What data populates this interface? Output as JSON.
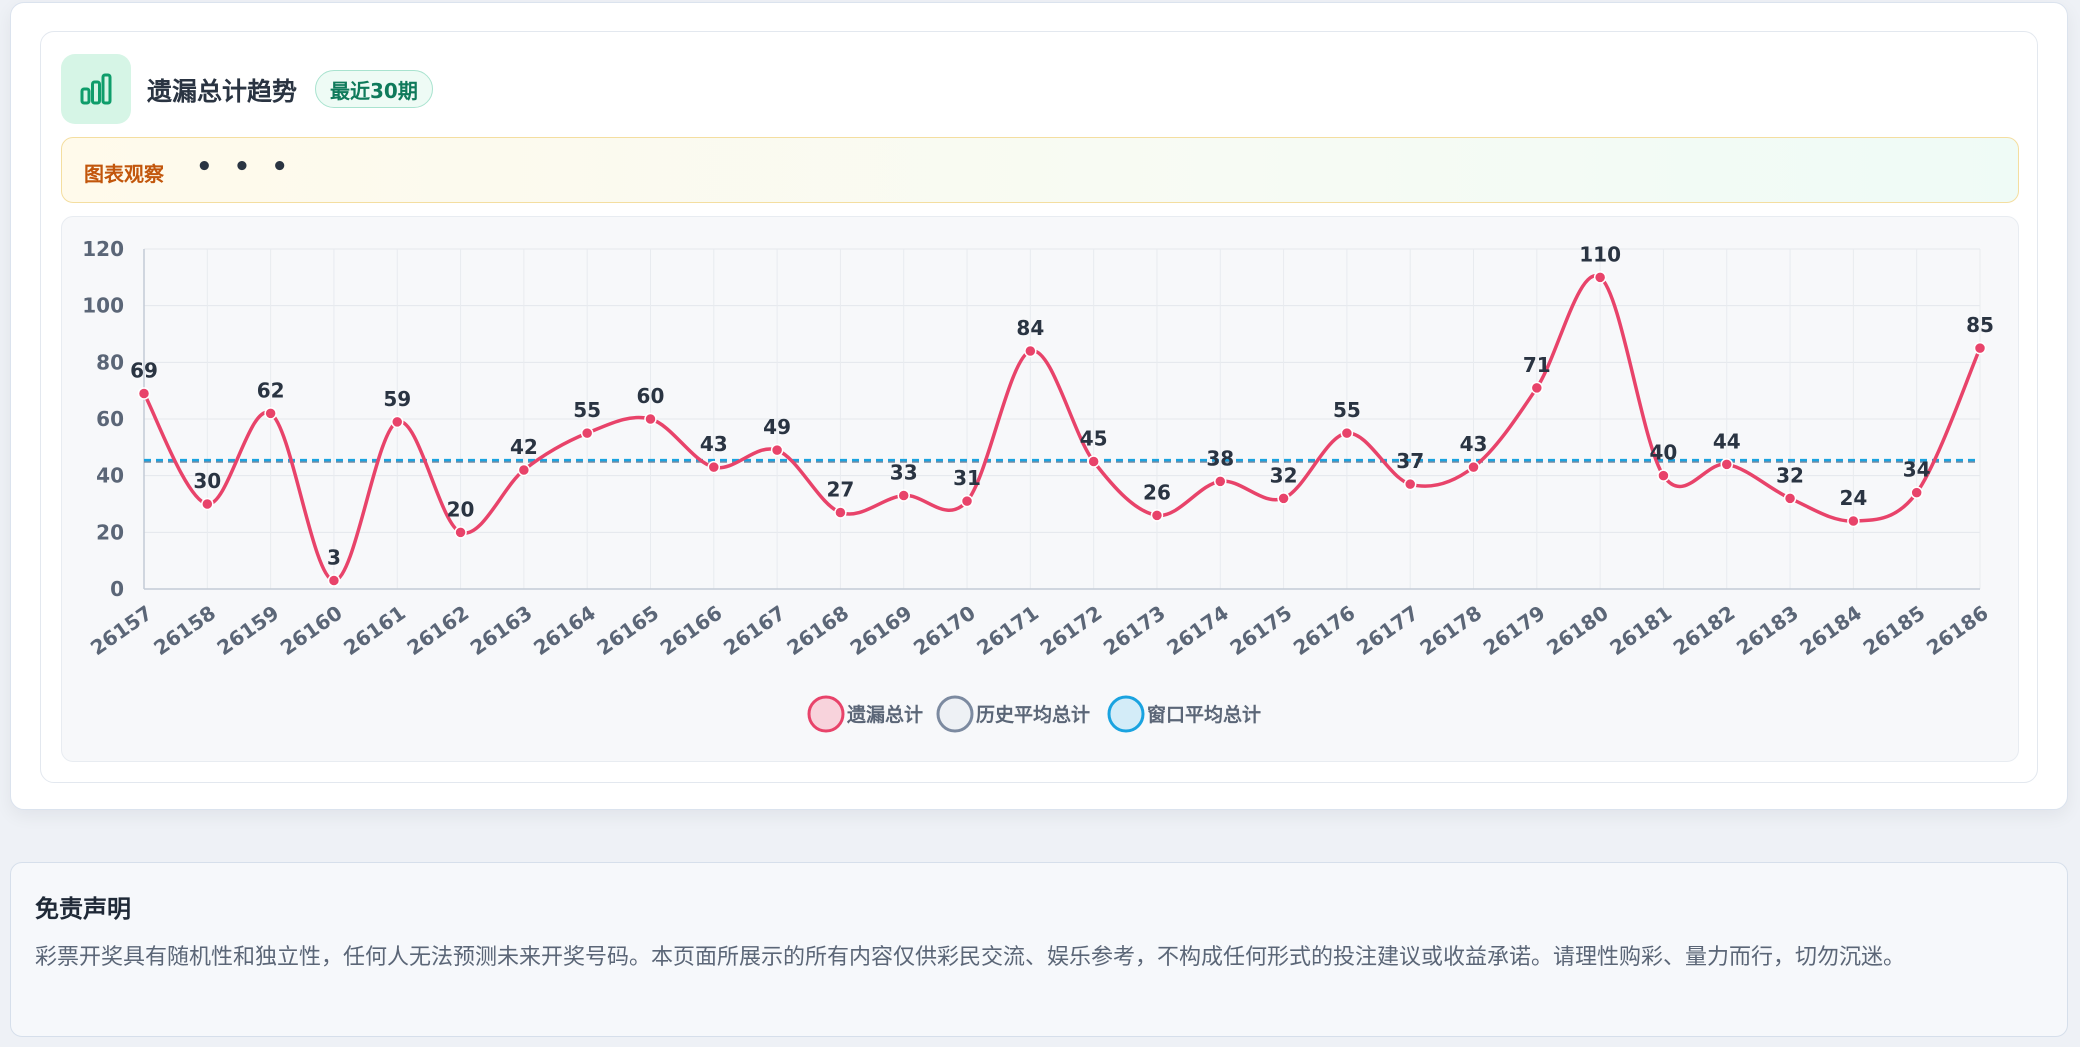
{
  "card": {
    "title": "遗漏总计趋势",
    "badge": "最近30期",
    "icon": "bar-chart-icon",
    "notice_label": "图表观察",
    "notice_dots": "• • •"
  },
  "chart_data": {
    "type": "line",
    "categories": [
      "26157",
      "26158",
      "26159",
      "26160",
      "26161",
      "26162",
      "26163",
      "26164",
      "26165",
      "26166",
      "26167",
      "26168",
      "26169",
      "26170",
      "26171",
      "26172",
      "26173",
      "26174",
      "26175",
      "26176",
      "26177",
      "26178",
      "26179",
      "26180",
      "26181",
      "26182",
      "26183",
      "26184",
      "26185",
      "26186"
    ],
    "series": [
      {
        "name": "遗漏总计",
        "color": "#e8436a",
        "values": [
          69,
          30,
          62,
          3,
          59,
          20,
          42,
          55,
          60,
          43,
          49,
          27,
          33,
          31,
          84,
          45,
          26,
          38,
          32,
          55,
          37,
          43,
          71,
          110,
          40,
          44,
          32,
          24,
          34,
          85
        ]
      },
      {
        "name": "历史平均总计",
        "color": "#7c8aa0",
        "constant": 45
      },
      {
        "name": "窗口平均总计",
        "color": "#1aa3e0",
        "constant": 45.5
      }
    ],
    "y_ticks": [
      "0",
      "20",
      "40",
      "60",
      "80",
      "100",
      "120"
    ],
    "ylim": [
      0,
      120
    ],
    "grid": true,
    "legend_position": "bottom-center"
  },
  "disclaimer": {
    "title": "免责声明",
    "text": "彩票开奖具有随机性和独立性，任何人无法预测未来开奖号码。本页面所展示的所有内容仅供彩民交流、娱乐参考，不构成任何形式的投注建议或收益承诺。请理性购彩、量力而行，切勿沉迷。"
  }
}
